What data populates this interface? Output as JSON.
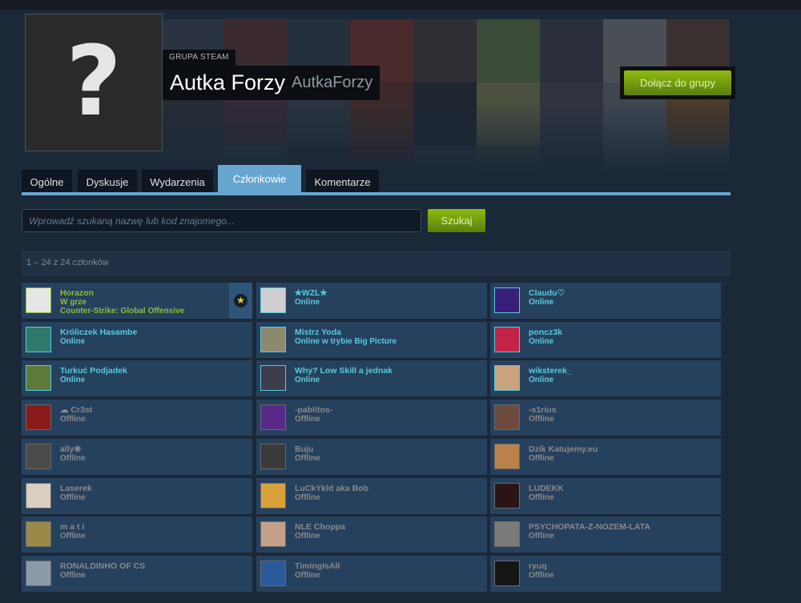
{
  "group": {
    "kind_label": "GRUPA STEAM",
    "name": "Autka Forzy",
    "abbreviation": "AutkaForzy",
    "avatar_glyph": "?",
    "join_button": "Dołącz do grupy"
  },
  "tabs": [
    {
      "label": "Ogólne",
      "active": false
    },
    {
      "label": "Dyskusje",
      "active": false
    },
    {
      "label": "Wydarzenia",
      "active": false
    },
    {
      "label": "Członkowie",
      "active": true
    },
    {
      "label": "Komentarze",
      "active": false
    }
  ],
  "search": {
    "placeholder": "Wprowadź szukaną nazwę lub kod znajomego...",
    "button_label": "Szukaj"
  },
  "member_count_text": "1 – 24 z 24 członków",
  "members": [
    {
      "name": "Horazon",
      "status": "W grze",
      "game": "Counter-Strike: Global Offensive",
      "state": "ingame",
      "officer": true,
      "avatar_color": "#e6e6e6"
    },
    {
      "name": "✯WZL✯",
      "status": "Online",
      "state": "online",
      "avatar_color": "#cfcfcf"
    },
    {
      "name": "Claudu♡",
      "status": "Online",
      "state": "online",
      "avatar_color": "#3a1f7a"
    },
    {
      "name": "Króliczek Hasambe",
      "status": "Online",
      "state": "online",
      "avatar_color": "#2f7a6a"
    },
    {
      "name": "Mistrz Yoda",
      "status": "Online w trybie Big Picture",
      "state": "online",
      "avatar_color": "#8c8a6e"
    },
    {
      "name": "poncz3k",
      "status": "Online",
      "state": "online",
      "avatar_color": "#c2234a"
    },
    {
      "name": "Turkuć Podjadek",
      "status": "Online",
      "state": "online",
      "avatar_color": "#5e7a3a"
    },
    {
      "name": "Why? Low Skill a jednak",
      "status": "Online",
      "state": "online",
      "avatar_color": "#3c3c4a"
    },
    {
      "name": "wiksterek_",
      "status": "Online",
      "state": "online",
      "avatar_color": "#c9a27e"
    },
    {
      "name": "☁ Cr3st",
      "status": "Offline",
      "state": "offline",
      "avatar_color": "#8a1b1b"
    },
    {
      "name": "-pablitos-",
      "status": "Offline",
      "state": "offline",
      "avatar_color": "#5a2a8a"
    },
    {
      "name": "-s1rius",
      "status": "Offline",
      "state": "offline",
      "avatar_color": "#6e4a3e"
    },
    {
      "name": "ally❀",
      "status": "Offline",
      "state": "offline",
      "avatar_color": "#4a4a4a"
    },
    {
      "name": "Buju",
      "status": "Offline",
      "state": "offline",
      "avatar_color": "#3a3a3a"
    },
    {
      "name": "Dzik Katujemy.eu",
      "status": "Offline",
      "state": "offline",
      "avatar_color": "#b9824a"
    },
    {
      "name": "Laserek",
      "status": "Offline",
      "state": "offline",
      "avatar_color": "#d8cfc0"
    },
    {
      "name": "LuCkYkld aka Bob",
      "status": "Offline",
      "state": "offline",
      "avatar_color": "#d9a13a"
    },
    {
      "name": "LUDEKK",
      "status": "Offline",
      "state": "offline",
      "avatar_color": "#2a1414"
    },
    {
      "name": "m a t i",
      "status": "Offline",
      "state": "offline",
      "avatar_color": "#9a8a4a"
    },
    {
      "name": "NLE Choppa",
      "status": "Offline",
      "state": "offline",
      "avatar_color": "#c4a08a"
    },
    {
      "name": "PSYCHOPATA-Z-NOZEM-LATA",
      "status": "Offline",
      "state": "offline",
      "avatar_color": "#7a7a7a"
    },
    {
      "name": "RONALDINHO OF CS",
      "status": "Offline",
      "state": "offline",
      "avatar_color": "#8a9aa8"
    },
    {
      "name": "TimingIsAll",
      "status": "Offline",
      "state": "offline",
      "avatar_color": "#2a5a9a"
    },
    {
      "name": "ryuq",
      "status": "Offline",
      "state": "offline",
      "avatar_color": "#151515"
    }
  ],
  "banner_tiles": [
    "#2c3340",
    "#3a2a2e",
    "#24303c",
    "#4a2a2a",
    "#2e2e34",
    "#3c4a3a",
    "#2a2f3a",
    "#4a4f56",
    "#3a3030",
    "#262c36",
    "#342a36",
    "#2a3440",
    "#3c2a2a",
    "#1e2630",
    "#4a5040",
    "#2f3440",
    "#3e4650",
    "#4a3a2a",
    "#2a3038",
    "#303a44",
    "#24262e",
    "#3a2424",
    "#2c3440",
    "#3a4036",
    "#2a2e38",
    "#40464e",
    "#3a4048"
  ]
}
